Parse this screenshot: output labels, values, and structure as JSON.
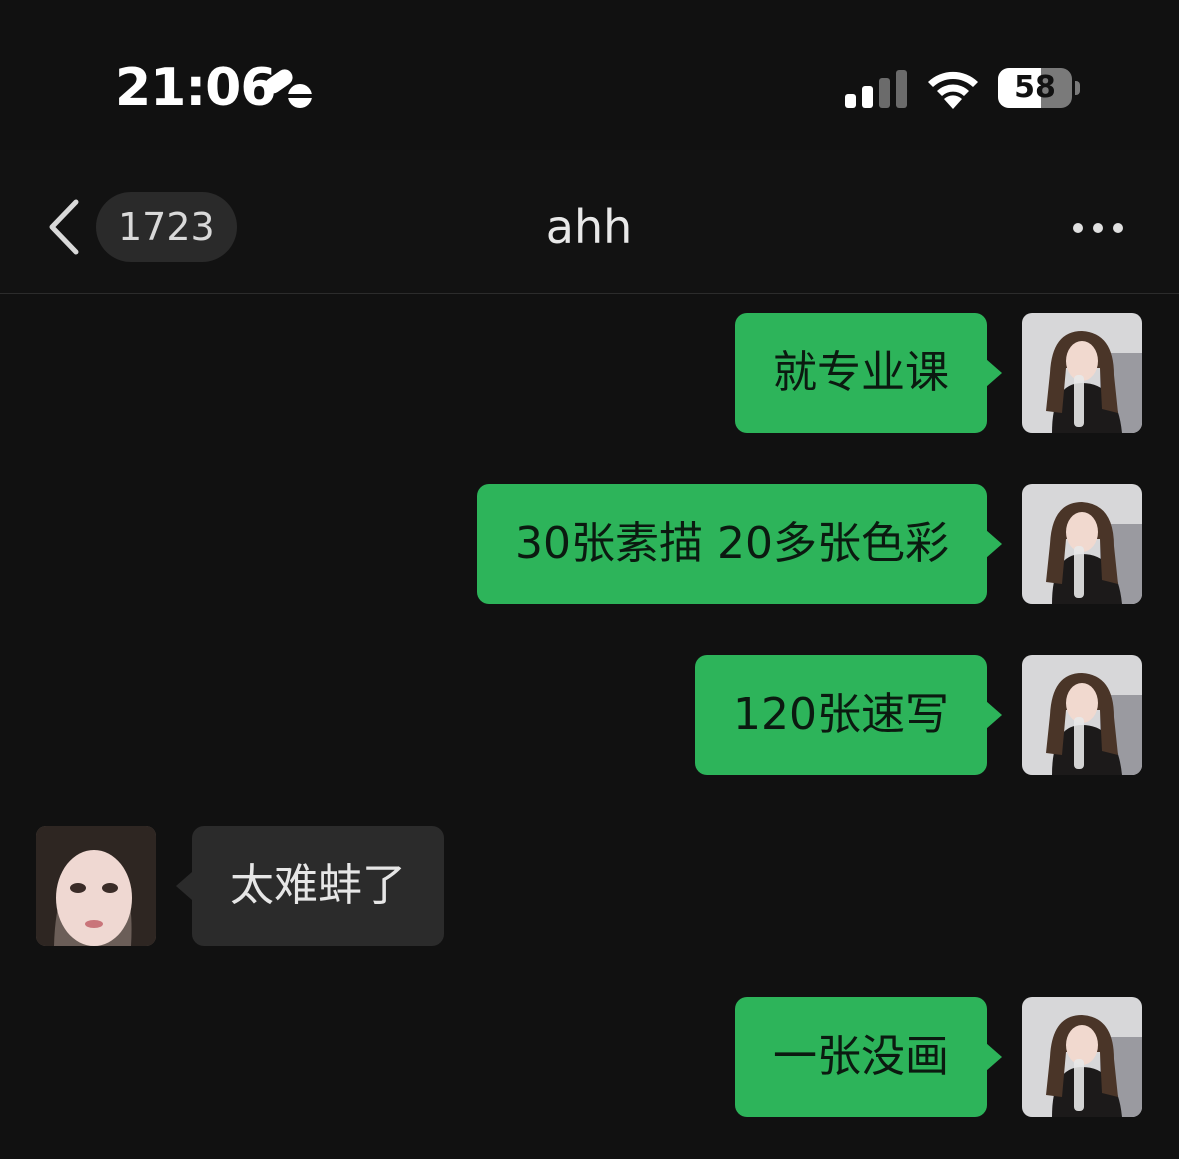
{
  "status_bar": {
    "time": "21:06",
    "battery_level": "58",
    "battery_fraction": 0.58,
    "icons": [
      "focus-mode-icon",
      "cellular-signal-icon",
      "wifi-icon",
      "battery-icon"
    ]
  },
  "nav": {
    "back_icon": "chevron-left-icon",
    "unread_count": "1723",
    "title": "ahh",
    "more_icon": "ellipsis-icon"
  },
  "messages": [
    {
      "direction": "outgoing",
      "text": "就专业课"
    },
    {
      "direction": "outgoing",
      "text": "30张素描 20多张色彩"
    },
    {
      "direction": "outgoing",
      "text": "120张速写"
    },
    {
      "direction": "incoming",
      "text": "太难蚌了"
    },
    {
      "direction": "outgoing",
      "text": "一张没画"
    }
  ],
  "colors": {
    "background": "#111111",
    "outgoing_bubble": "#2db45a",
    "incoming_bubble": "#2b2b2b",
    "badge": "#2a2a2a"
  }
}
